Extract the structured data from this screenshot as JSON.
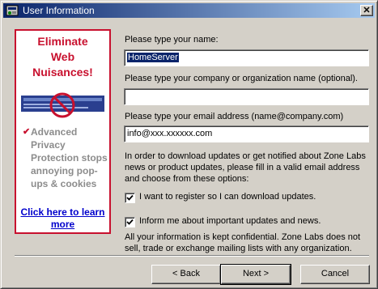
{
  "window": {
    "title": "User Information",
    "close_label": "✕"
  },
  "ad": {
    "headline": [
      "Eliminate",
      "Web",
      "Nuisances!"
    ],
    "check_mark": "✔",
    "body": "Advanced Privacy Protection stops annoying pop-ups & cookies",
    "link": "Click here to learn more",
    "brand_color": "#c8102e"
  },
  "form": {
    "name_label": "Please type your name:",
    "name_value": "HomeServer",
    "company_label": "Please type your company or organization name (optional).",
    "company_value": "",
    "email_label": "Please type your email address (name@company.com)",
    "email_value": "info@xxx.xxxxxx.com",
    "instructions": "In order to download updates or get notified about Zone Labs news or product updates, please fill in a valid email address and choose from these options:",
    "register_label": "I want to register so I can download updates.",
    "register_checked": true,
    "inform_label": "Inform me about important updates and news.",
    "inform_checked": true,
    "privacy_note": "All your information is kept confidential. Zone Labs does not sell, trade or exchange mailing lists with any organization."
  },
  "buttons": {
    "back": "< Back",
    "next": "Next >",
    "cancel": "Cancel"
  }
}
